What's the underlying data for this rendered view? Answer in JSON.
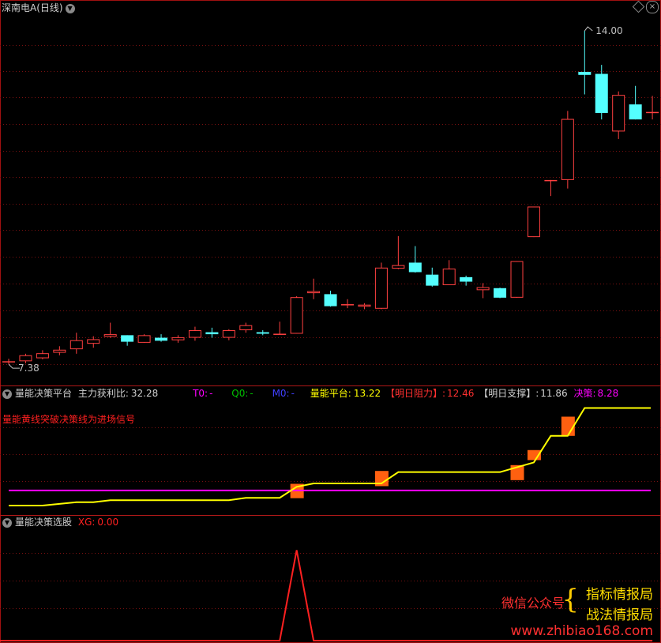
{
  "panel1": {
    "title": "深南电A(日线)",
    "price_high_label": "14.00",
    "price_low_label": "7.38"
  },
  "panel2": {
    "title": "量能决策平台",
    "ratio_label": "主力获利比:",
    "ratio_value": "32.28",
    "t0_label": "T0:",
    "t0_value": "-",
    "q0_label": "Q0:",
    "q0_value": "-",
    "m0_label": "M0:",
    "m0_value": "-",
    "platform_label": "量能平台:",
    "platform_value": "13.22",
    "resist_label": "【明日阻力】:",
    "resist_value": "12.46",
    "support_label": "【明日支撑】:",
    "support_value": "11.86",
    "decision_label": "决策:",
    "decision_value": "8.28",
    "note": "量能黄线突破决策线为进场信号"
  },
  "panel3": {
    "title": "量能决策选股",
    "xg_label": "XG:",
    "xg_value": "0.00"
  },
  "watermark": {
    "prefix": "微信公众号",
    "line1": "指标情报局",
    "line2": "战法情报局",
    "url": "www.zhibiao168.com"
  },
  "colors": {
    "up": "#ff4040",
    "down": "#54ffff",
    "yellow_line": "#ffff00",
    "magenta_line": "#ff00ff",
    "signal": "#ff6010",
    "xg_line": "#ff2020"
  },
  "chart_data": [
    {
      "type": "candlestick",
      "title": "深南电A(日线)",
      "ylim": [
        7.2,
        14.3
      ],
      "candles": [
        {
          "o": 7.38,
          "h": 7.45,
          "l": 7.34,
          "c": 7.4
        },
        {
          "o": 7.4,
          "h": 7.55,
          "l": 7.36,
          "c": 7.52
        },
        {
          "o": 7.46,
          "h": 7.62,
          "l": 7.44,
          "c": 7.56
        },
        {
          "o": 7.57,
          "h": 7.7,
          "l": 7.52,
          "c": 7.63
        },
        {
          "o": 7.64,
          "h": 7.97,
          "l": 7.55,
          "c": 7.82
        },
        {
          "o": 7.75,
          "h": 7.9,
          "l": 7.67,
          "c": 7.84
        },
        {
          "o": 7.89,
          "h": 8.17,
          "l": 7.87,
          "c": 7.94
        },
        {
          "o": 7.92,
          "h": 7.92,
          "l": 7.71,
          "c": 7.79
        },
        {
          "o": 7.77,
          "h": 7.94,
          "l": 7.77,
          "c": 7.92
        },
        {
          "o": 7.87,
          "h": 7.94,
          "l": 7.79,
          "c": 7.81
        },
        {
          "o": 7.82,
          "h": 7.92,
          "l": 7.77,
          "c": 7.88
        },
        {
          "o": 7.87,
          "h": 8.09,
          "l": 7.81,
          "c": 8.02
        },
        {
          "o": 7.98,
          "h": 8.07,
          "l": 7.87,
          "c": 7.94
        },
        {
          "o": 7.87,
          "h": 8.04,
          "l": 7.82,
          "c": 8.02
        },
        {
          "o": 8.02,
          "h": 8.17,
          "l": 7.97,
          "c": 8.12
        },
        {
          "o": 7.98,
          "h": 8.02,
          "l": 7.92,
          "c": 7.95
        },
        {
          "o": 7.94,
          "h": 8.19,
          "l": 7.94,
          "c": 7.95
        },
        {
          "o": 7.95,
          "h": 8.7,
          "l": 7.95,
          "c": 8.68
        },
        {
          "o": 8.76,
          "h": 9.05,
          "l": 8.64,
          "c": 8.8
        },
        {
          "o": 8.74,
          "h": 8.81,
          "l": 8.49,
          "c": 8.5
        },
        {
          "o": 8.53,
          "h": 8.64,
          "l": 8.46,
          "c": 8.54
        },
        {
          "o": 8.49,
          "h": 8.56,
          "l": 8.44,
          "c": 8.53
        },
        {
          "o": 8.45,
          "h": 9.37,
          "l": 8.44,
          "c": 9.27
        },
        {
          "o": 9.25,
          "h": 9.9,
          "l": 9.24,
          "c": 9.32
        },
        {
          "o": 9.37,
          "h": 9.7,
          "l": 9.17,
          "c": 9.18
        },
        {
          "o": 9.13,
          "h": 9.27,
          "l": 8.89,
          "c": 8.91
        },
        {
          "o": 8.92,
          "h": 9.42,
          "l": 8.92,
          "c": 9.25
        },
        {
          "o": 9.08,
          "h": 9.11,
          "l": 8.91,
          "c": 8.99
        },
        {
          "o": 8.82,
          "h": 8.96,
          "l": 8.66,
          "c": 8.88
        },
        {
          "o": 8.86,
          "h": 8.87,
          "l": 8.66,
          "c": 8.67
        },
        {
          "o": 8.67,
          "h": 9.4,
          "l": 8.67,
          "c": 9.4
        },
        {
          "o": 9.88,
          "h": 10.49,
          "l": 9.88,
          "c": 10.49
        },
        {
          "o": 11.02,
          "h": 11.02,
          "l": 10.7,
          "c": 11.02
        },
        {
          "o": 11.02,
          "h": 12.4,
          "l": 10.85,
          "c": 12.24
        },
        {
          "o": 13.18,
          "h": 14.0,
          "l": 12.73,
          "c": 13.12
        },
        {
          "o": 13.14,
          "h": 13.32,
          "l": 12.23,
          "c": 12.36
        },
        {
          "o": 11.99,
          "h": 12.79,
          "l": 11.84,
          "c": 12.72
        },
        {
          "o": 12.53,
          "h": 12.9,
          "l": 12.23,
          "c": 12.23
        },
        {
          "o": 12.38,
          "h": 12.7,
          "l": 12.23,
          "c": 12.38
        }
      ]
    },
    {
      "type": "line",
      "title": "量能决策平台",
      "ylim": [
        7.0,
        14.0
      ],
      "series": [
        {
          "name": "量能平台",
          "points": [
            [
              0,
              7.38
            ],
            [
              2,
              7.38
            ],
            [
              4,
              7.58
            ],
            [
              5,
              7.58
            ],
            [
              6,
              7.7
            ],
            [
              13,
              7.7
            ],
            [
              14,
              7.84
            ],
            [
              16,
              7.84
            ],
            [
              17,
              8.5
            ],
            [
              18,
              8.7
            ],
            [
              22,
              8.7
            ],
            [
              23,
              9.38
            ],
            [
              29,
              9.38
            ],
            [
              31,
              9.96
            ],
            [
              32,
              11.55
            ],
            [
              33,
              11.55
            ],
            [
              34,
              13.22
            ],
            [
              38,
              13.22
            ]
          ]
        },
        {
          "name": "决策",
          "points": [
            [
              0,
              8.28
            ],
            [
              38,
              8.28
            ]
          ]
        }
      ],
      "signals": [
        {
          "x": 17,
          "lo": 7.82,
          "hi": 8.68
        },
        {
          "x": 22,
          "lo": 8.54,
          "hi": 9.45
        },
        {
          "x": 30,
          "lo": 8.9,
          "hi": 9.8
        },
        {
          "x": 31,
          "lo": 10.1,
          "hi": 10.7
        },
        {
          "x": 33,
          "lo": 11.55,
          "hi": 12.7
        }
      ]
    },
    {
      "type": "line",
      "title": "量能决策选股",
      "ylim": [
        0,
        1.3
      ],
      "series": [
        {
          "name": "XG",
          "values": [
            0,
            0,
            0,
            0,
            0,
            0,
            0,
            0,
            0,
            0,
            0,
            0,
            0,
            0,
            0,
            0,
            0,
            1,
            0,
            0,
            0,
            0,
            0,
            0,
            0,
            0,
            0,
            0,
            0,
            0,
            0,
            0,
            0,
            0,
            0,
            0,
            0,
            0,
            0
          ]
        }
      ]
    }
  ]
}
